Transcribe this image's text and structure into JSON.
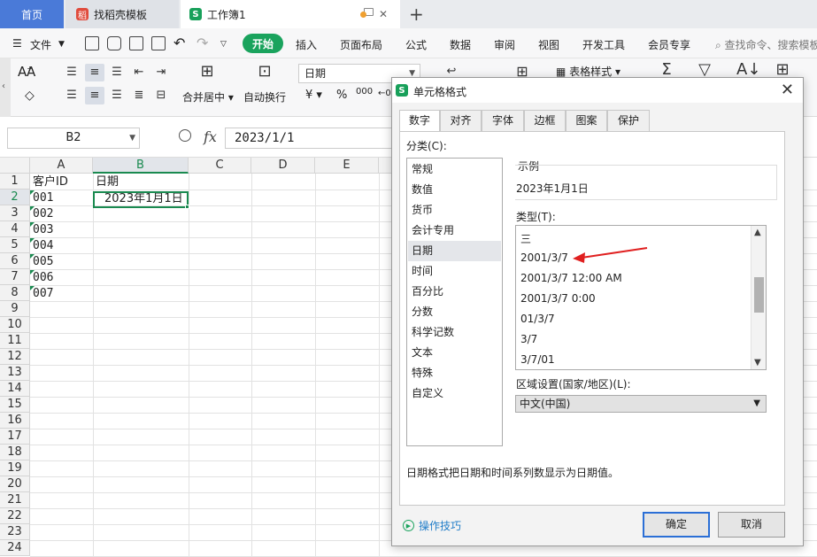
{
  "tabs": [
    {
      "label": "首页"
    },
    {
      "label": "找稻壳模板"
    },
    {
      "label": "工作簿1"
    }
  ],
  "menu": {
    "file": "文件",
    "items": [
      "开始",
      "插入",
      "页面布局",
      "公式",
      "数据",
      "审阅",
      "视图",
      "开发工具",
      "会员专享"
    ],
    "search_placeholder": "查找命令、搜索模板"
  },
  "ribbon": {
    "font_sample": "A",
    "number_format": "日期",
    "merge_label": "合并居中",
    "wrap_label": "自动换行",
    "table_style_label": "表格样式",
    "currency_symbol": "¥",
    "percent_symbol": "%",
    "thousands_symbol": "000"
  },
  "formula_bar": {
    "name_box": "B2",
    "fx": "fx",
    "value": "2023/1/1"
  },
  "grid": {
    "columns": [
      "A",
      "B",
      "C",
      "D",
      "E"
    ],
    "rows": [
      "1",
      "2",
      "3",
      "4",
      "5",
      "6",
      "7",
      "8",
      "9",
      "10",
      "11",
      "12",
      "13",
      "14",
      "15",
      "16",
      "17",
      "18",
      "19",
      "20",
      "21",
      "22",
      "23",
      "24"
    ],
    "header_a": "客户ID",
    "header_b": "日期",
    "ids": [
      "001",
      "002",
      "003",
      "004",
      "005",
      "006",
      "007"
    ],
    "b2": "2023年1月1日"
  },
  "dialog": {
    "title": "单元格格式",
    "tabs": [
      "数字",
      "对齐",
      "字体",
      "边框",
      "图案",
      "保护"
    ],
    "category_label": "分类(C):",
    "categories": [
      "常规",
      "数值",
      "货币",
      "会计专用",
      "日期",
      "时间",
      "百分比",
      "分数",
      "科学记数",
      "文本",
      "特殊",
      "自定义"
    ],
    "sample_label": "示例",
    "sample_value": "2023年1月1日",
    "type_label": "类型(T):",
    "types": [
      "三",
      "2001/3/7",
      "2001/3/7 12:00 AM",
      "2001/3/7 0:00",
      "01/3/7",
      "3/7",
      "3/7/01"
    ],
    "region_label": "区域设置(国家/地区)(L):",
    "region_value": "中文(中国)",
    "description": "日期格式把日期和时间系列数显示为日期值。",
    "tips": "操作技巧",
    "ok": "确定",
    "cancel": "取消"
  },
  "colors": {
    "accent_green": "#1aa35d",
    "home_tab_blue": "#4a7ad8",
    "arrow_red": "#e02020"
  }
}
